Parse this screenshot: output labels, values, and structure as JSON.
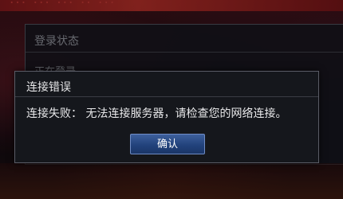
{
  "background": {
    "banner_text": "··· ··· ··· ·· ···"
  },
  "status_panel": {
    "title": "登录状态",
    "status_text": "正在登录……"
  },
  "dialog": {
    "title": "连接错误",
    "message": "连接失败： 无法连接服务器，请检查您的网络连接。",
    "confirm_label": "确认"
  },
  "colors": {
    "button_top": "#3d5f9c",
    "button_bottom": "#1a3567",
    "dialog_bg": "#15171c",
    "text": "#e8e8ea"
  }
}
